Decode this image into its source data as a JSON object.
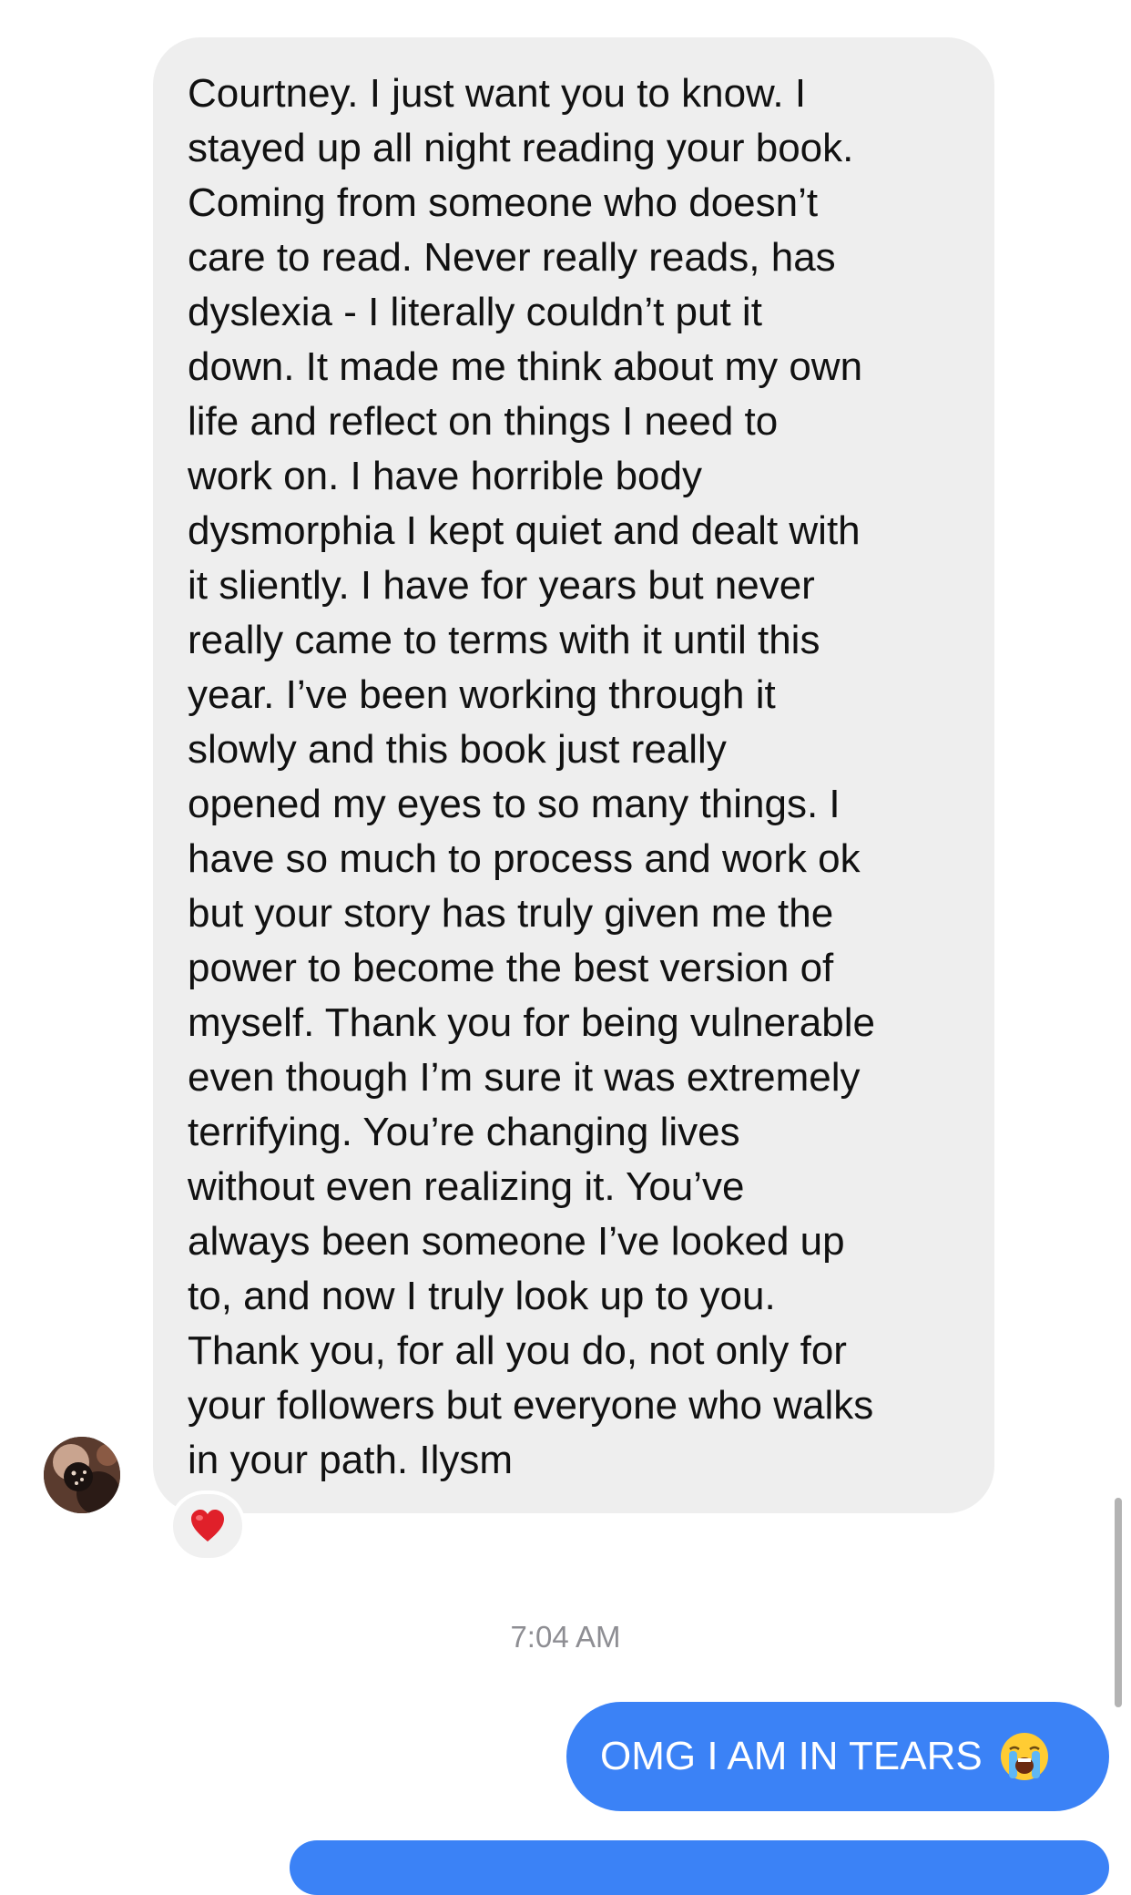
{
  "conversation": {
    "incoming": {
      "text": "Courtney. I just want you to know. I\nstayed up all night reading your book.\nComing from someone who doesn’t\ncare to read. Never really reads, has\ndyslexia - I literally couldn’t put it\ndown. It made me think about my own\nlife and reflect on things I need to\nwork on. I have horrible body\ndysmorphia I kept quiet and dealt with\nit sliently. I have for years but never\nreally came to terms with it until this\nyear. I’ve been working through it\nslowly and this book just really\nopened my eyes to so many things. I\nhave so much to process and work ok\nbut your story has truly given me the\npower to become the best version of\nmyself. Thank you for being vulnerable\neven though I’m sure it was extremely\nterrifying. You’re changing lives\nwithout even realizing it. You’ve\nalways been someone I’ve looked up\nto, and now I truly look up to you.\nThank you, for all you do, not only for\nyour followers but everyone who walks\nin your path. Ilysm",
      "reaction_icon": "red-heart-icon",
      "avatar_icon": "sender-avatar"
    },
    "timestamp": "7:04 AM",
    "outgoing": {
      "text": "OMG I AM IN TEARS",
      "emoji_icon": "loudly-crying-face-icon"
    }
  },
  "colors": {
    "incoming_bubble": "#eeeeee",
    "outgoing_bubble": "#3b82f6",
    "timestamp": "#8e8e93",
    "heart": "#e0202a"
  }
}
